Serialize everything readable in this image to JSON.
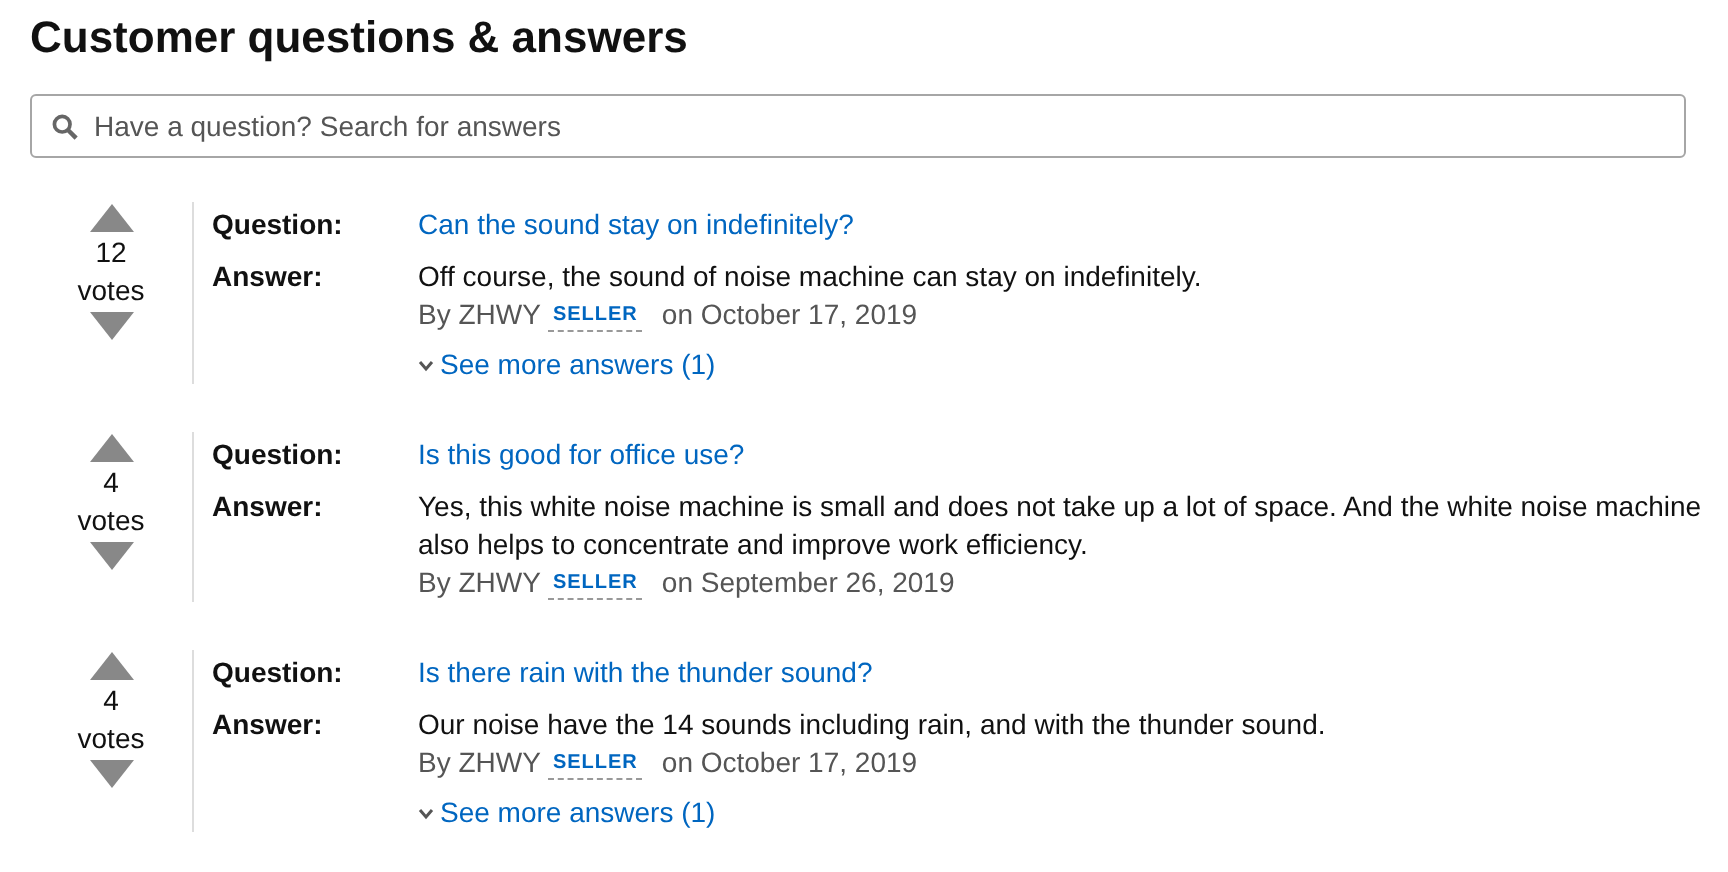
{
  "title": "Customer questions & answers",
  "search": {
    "placeholder": "Have a question? Search for answers"
  },
  "questions": [
    {
      "votes": "12",
      "votes_label": "votes",
      "question_label": "Question:",
      "question": "Can the sound stay on indefinitely?",
      "answer_label": "Answer:",
      "answer": "Off course, the sound of noise machine can stay on indefinitely.",
      "author": "By ZHWY",
      "badge": "SELLER",
      "date": "on October 17, 2019",
      "see_more": "See more answers (1)"
    },
    {
      "votes": "4",
      "votes_label": "votes",
      "question_label": "Question:",
      "question": "Is this good for office use?",
      "answer_label": "Answer:",
      "answer": "Yes, this white noise machine is small and does not take up a lot of space. And the white noise machine also helps to concentrate and improve work efficiency.",
      "author": "By ZHWY",
      "badge": "SELLER",
      "date": "on September 26, 2019"
    },
    {
      "votes": "4",
      "votes_label": "votes",
      "question_label": "Question:",
      "question": "Is there rain with the thunder sound?",
      "answer_label": "Answer:",
      "answer": "Our noise have the 14 sounds including rain, and with the thunder sound.",
      "author": "By ZHWY",
      "badge": "SELLER",
      "date": "on October 17, 2019",
      "see_more": "See more answers (1)"
    }
  ]
}
